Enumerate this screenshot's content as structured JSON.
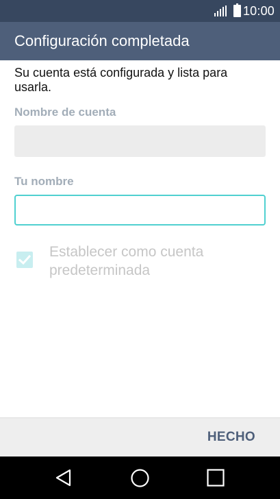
{
  "status_bar": {
    "time": "10:00",
    "icons": [
      "signal-icon",
      "battery-icon"
    ]
  },
  "app_bar": {
    "title": "Configuración completada"
  },
  "content": {
    "info_text": "Su cuenta está configurada y lista para usarla.",
    "account_name_label": "Nombre de cuenta",
    "account_name_value": "",
    "your_name_label": "Tu nombre",
    "your_name_value": "",
    "default_account_label": "Establecer como cuenta predeterminada",
    "default_account_checked": true
  },
  "bottom_bar": {
    "done_label": "HECHO"
  },
  "nav_bar": {
    "icons": [
      "back-icon",
      "home-icon",
      "recent-apps-icon"
    ]
  },
  "colors": {
    "status_bar": "#37475f",
    "app_bar": "#4e5f7a",
    "accent": "#4fd0d0",
    "label": "#a2adb8"
  }
}
